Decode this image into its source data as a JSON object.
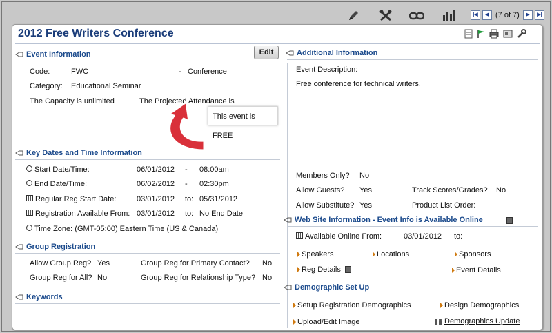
{
  "toolbar": {
    "icons": [
      "pencil-icon",
      "tools-icon",
      "link-icon",
      "chart-icon"
    ],
    "record_position": "(7 of 7)"
  },
  "page_title": "2012 Free Writers Conference",
  "title_icons": [
    "document-icon",
    "flag-icon",
    "printer-icon",
    "id-card-icon",
    "wrench-icon"
  ],
  "event_info": {
    "heading": "Event Information",
    "edit_label": "Edit",
    "code_label": "Code:",
    "code_value": "FWC",
    "type_dash": "-",
    "type_value": "Conference",
    "category_label": "Category:",
    "category_value": "Educational Seminar",
    "capacity_text": "The Capacity is unlimited",
    "attendance_text": "The Projected Attendance is",
    "free_callout": "This event is FREE"
  },
  "key_dates": {
    "heading": "Key Dates and Time Information",
    "start_label": "Start Date/Time:",
    "start_date": "06/01/2012",
    "start_dash": "-",
    "start_time": "08:00am",
    "end_label": "End Date/Time:",
    "end_date": "06/02/2012",
    "end_dash": "-",
    "end_time": "02:30pm",
    "reg_start_label": "Regular Reg Start Date:",
    "reg_start_date": "03/01/2012",
    "reg_start_to": "to:",
    "reg_start_end": "05/31/2012",
    "reg_avail_label": "Registration Available From:",
    "reg_avail_date": "03/01/2012",
    "reg_avail_to": "to:",
    "reg_avail_end": "No End Date",
    "timezone_text": "Time Zone: (GMT-05:00) Eastern Time (US & Canada)"
  },
  "group_reg": {
    "heading": "Group Registration",
    "allow_label": "Allow Group Reg?",
    "allow_value": "Yes",
    "primary_label": "Group Reg for Primary Contact?",
    "primary_value": "No",
    "all_label": "Group Reg for All?",
    "all_value": "No",
    "relationship_label": "Group Reg for Relationship Type?",
    "relationship_value": "No"
  },
  "keywords": {
    "heading": "Keywords"
  },
  "additional_info": {
    "heading": "Additional Information",
    "desc_label": "Event Description:",
    "desc_value": "Free conference for technical writers.",
    "members_label": "Members Only?",
    "members_value": "No",
    "guests_label": "Allow Guests?",
    "guests_value": "Yes",
    "track_label": "Track Scores/Grades?",
    "track_value": "No",
    "substitute_label": "Allow Substitute?",
    "substitute_value": "Yes",
    "product_label": "Product List Order:"
  },
  "website_info": {
    "heading": "Web Site Information - Event Info is Available Online",
    "available_label": "Available Online From:",
    "available_date": "03/01/2012",
    "available_to": "to:",
    "links": {
      "speakers": "Speakers",
      "locations": "Locations",
      "sponsors": "Sponsors",
      "reg_details": "Reg Details",
      "event_details": "Event Details"
    }
  },
  "demographics": {
    "heading": "Demographic Set Up",
    "setup_reg": "Setup Registration Demographics",
    "design": "Design Demographics",
    "upload": "Upload/Edit Image",
    "update": "Demographics Update"
  },
  "colors": {
    "heading_blue": "#1b4a8c",
    "title_blue": "#1b3d7a",
    "link_arrow_orange": "#d07a10",
    "callout_arrow_red": "#d9303a"
  }
}
